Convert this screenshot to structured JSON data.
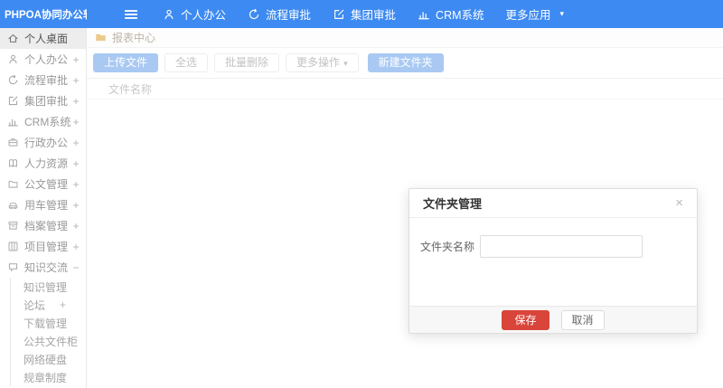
{
  "topbar": {
    "logo": "PHPOA协同办公软件",
    "nav": [
      {
        "label": "个人办公",
        "icon": "user-icon"
      },
      {
        "label": "流程审批",
        "icon": "history-icon"
      },
      {
        "label": "集团审批",
        "icon": "edit-icon"
      },
      {
        "label": "CRM系统",
        "icon": "chart-icon"
      },
      {
        "label": "更多应用",
        "icon": "caret-down-icon",
        "caret": "▾"
      }
    ]
  },
  "sidebar": {
    "items": [
      {
        "label": "个人桌面",
        "icon": "home-icon",
        "expand": "",
        "active": true
      },
      {
        "label": "个人办公",
        "icon": "user-icon",
        "expand": "+"
      },
      {
        "label": "流程审批",
        "icon": "history-icon",
        "expand": "+"
      },
      {
        "label": "集团审批",
        "icon": "edit-icon",
        "expand": "+"
      },
      {
        "label": "CRM系统",
        "icon": "chart-icon",
        "expand": "+"
      },
      {
        "label": "行政办公",
        "icon": "briefcase-icon",
        "expand": "+"
      },
      {
        "label": "人力资源",
        "icon": "book-icon",
        "expand": "+"
      },
      {
        "label": "公文管理",
        "icon": "folder-icon",
        "expand": "+"
      },
      {
        "label": "用车管理",
        "icon": "car-icon",
        "expand": "+"
      },
      {
        "label": "档案管理",
        "icon": "archive-icon",
        "expand": "+"
      },
      {
        "label": "项目管理",
        "icon": "project-icon",
        "expand": "+"
      },
      {
        "label": "知识交流",
        "icon": "chat-icon",
        "expand": "−"
      }
    ],
    "subitems": [
      {
        "label": "知识管理",
        "expand": ""
      },
      {
        "label": "论坛",
        "expand": "+"
      },
      {
        "label": "下载管理",
        "expand": ""
      },
      {
        "label": "公共文件柜",
        "expand": ""
      },
      {
        "label": "网络硬盘",
        "expand": ""
      },
      {
        "label": "规章制度",
        "expand": ""
      }
    ]
  },
  "content": {
    "breadcrumb": {
      "label": "报表中心",
      "icon": "folder-icon"
    },
    "toolbar": {
      "upload": "上传文件",
      "select_all": "全选",
      "batch_delete": "批量删除",
      "more_actions": "更多操作",
      "more_caret": "▾",
      "new_folder": "新建文件夹"
    },
    "table": {
      "columns": [
        "文件名称"
      ]
    }
  },
  "modal": {
    "title": "文件夹管理",
    "close": "×",
    "fields": [
      {
        "label": "文件夹名称",
        "value": ""
      }
    ],
    "buttons": {
      "save": "保存",
      "cancel": "取消"
    }
  },
  "colors": {
    "topbar_blue": "#3d8af2",
    "primary_button_faded": "#a9c9f3",
    "save_red": "#d9453a",
    "breadcrumb_folder_yellow": "#ecca8b"
  }
}
